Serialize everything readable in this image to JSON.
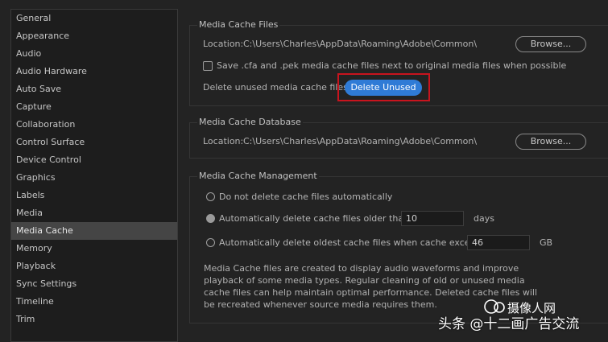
{
  "sidebar": {
    "items": [
      {
        "label": "General"
      },
      {
        "label": "Appearance"
      },
      {
        "label": "Audio"
      },
      {
        "label": "Audio Hardware"
      },
      {
        "label": "Auto Save"
      },
      {
        "label": "Capture"
      },
      {
        "label": "Collaboration"
      },
      {
        "label": "Control Surface"
      },
      {
        "label": "Device Control"
      },
      {
        "label": "Graphics"
      },
      {
        "label": "Labels"
      },
      {
        "label": "Media"
      },
      {
        "label": "Media Cache"
      },
      {
        "label": "Memory"
      },
      {
        "label": "Playback"
      },
      {
        "label": "Sync Settings"
      },
      {
        "label": "Timeline"
      },
      {
        "label": "Trim"
      }
    ],
    "selected": "Media Cache"
  },
  "media_cache_files": {
    "title": "Media Cache Files",
    "location_label": "Location:",
    "location_path": "C:\\Users\\Charles\\AppData\\Roaming\\Adobe\\Common\\",
    "browse_label": "Browse...",
    "save_checkbox_label": "Save .cfa and .pek media cache files next to original media files when possible",
    "save_checked": false,
    "delete_label": "Delete unused media cache files",
    "delete_button": "Delete Unused"
  },
  "media_cache_database": {
    "title": "Media Cache Database",
    "location_label": "Location:",
    "location_path": "C:\\Users\\Charles\\AppData\\Roaming\\Adobe\\Common\\",
    "browse_label": "Browse..."
  },
  "media_cache_management": {
    "title": "Media Cache Management",
    "option_none": "Do not delete cache files automatically",
    "option_older": "Automatically delete cache files older than:",
    "older_value": "10",
    "older_unit": "days",
    "option_size": "Automatically delete oldest cache files when cache exceeds:",
    "size_value": "46",
    "size_unit": "GB",
    "selected_option": "older",
    "description": "Media Cache files are created to display audio waveforms and improve playback of some media types.  Regular cleaning of old or unused media cache files can help maintain optimal performance. Deleted cache files will be recreated whenever source media requires them."
  },
  "watermark": {
    "text": "头条 @十二画广告交流",
    "logo_text": "摄像人网"
  },
  "colors": {
    "accent_button": "#2f7bd6",
    "highlight_box": "#c8141e",
    "background": "#232323"
  }
}
